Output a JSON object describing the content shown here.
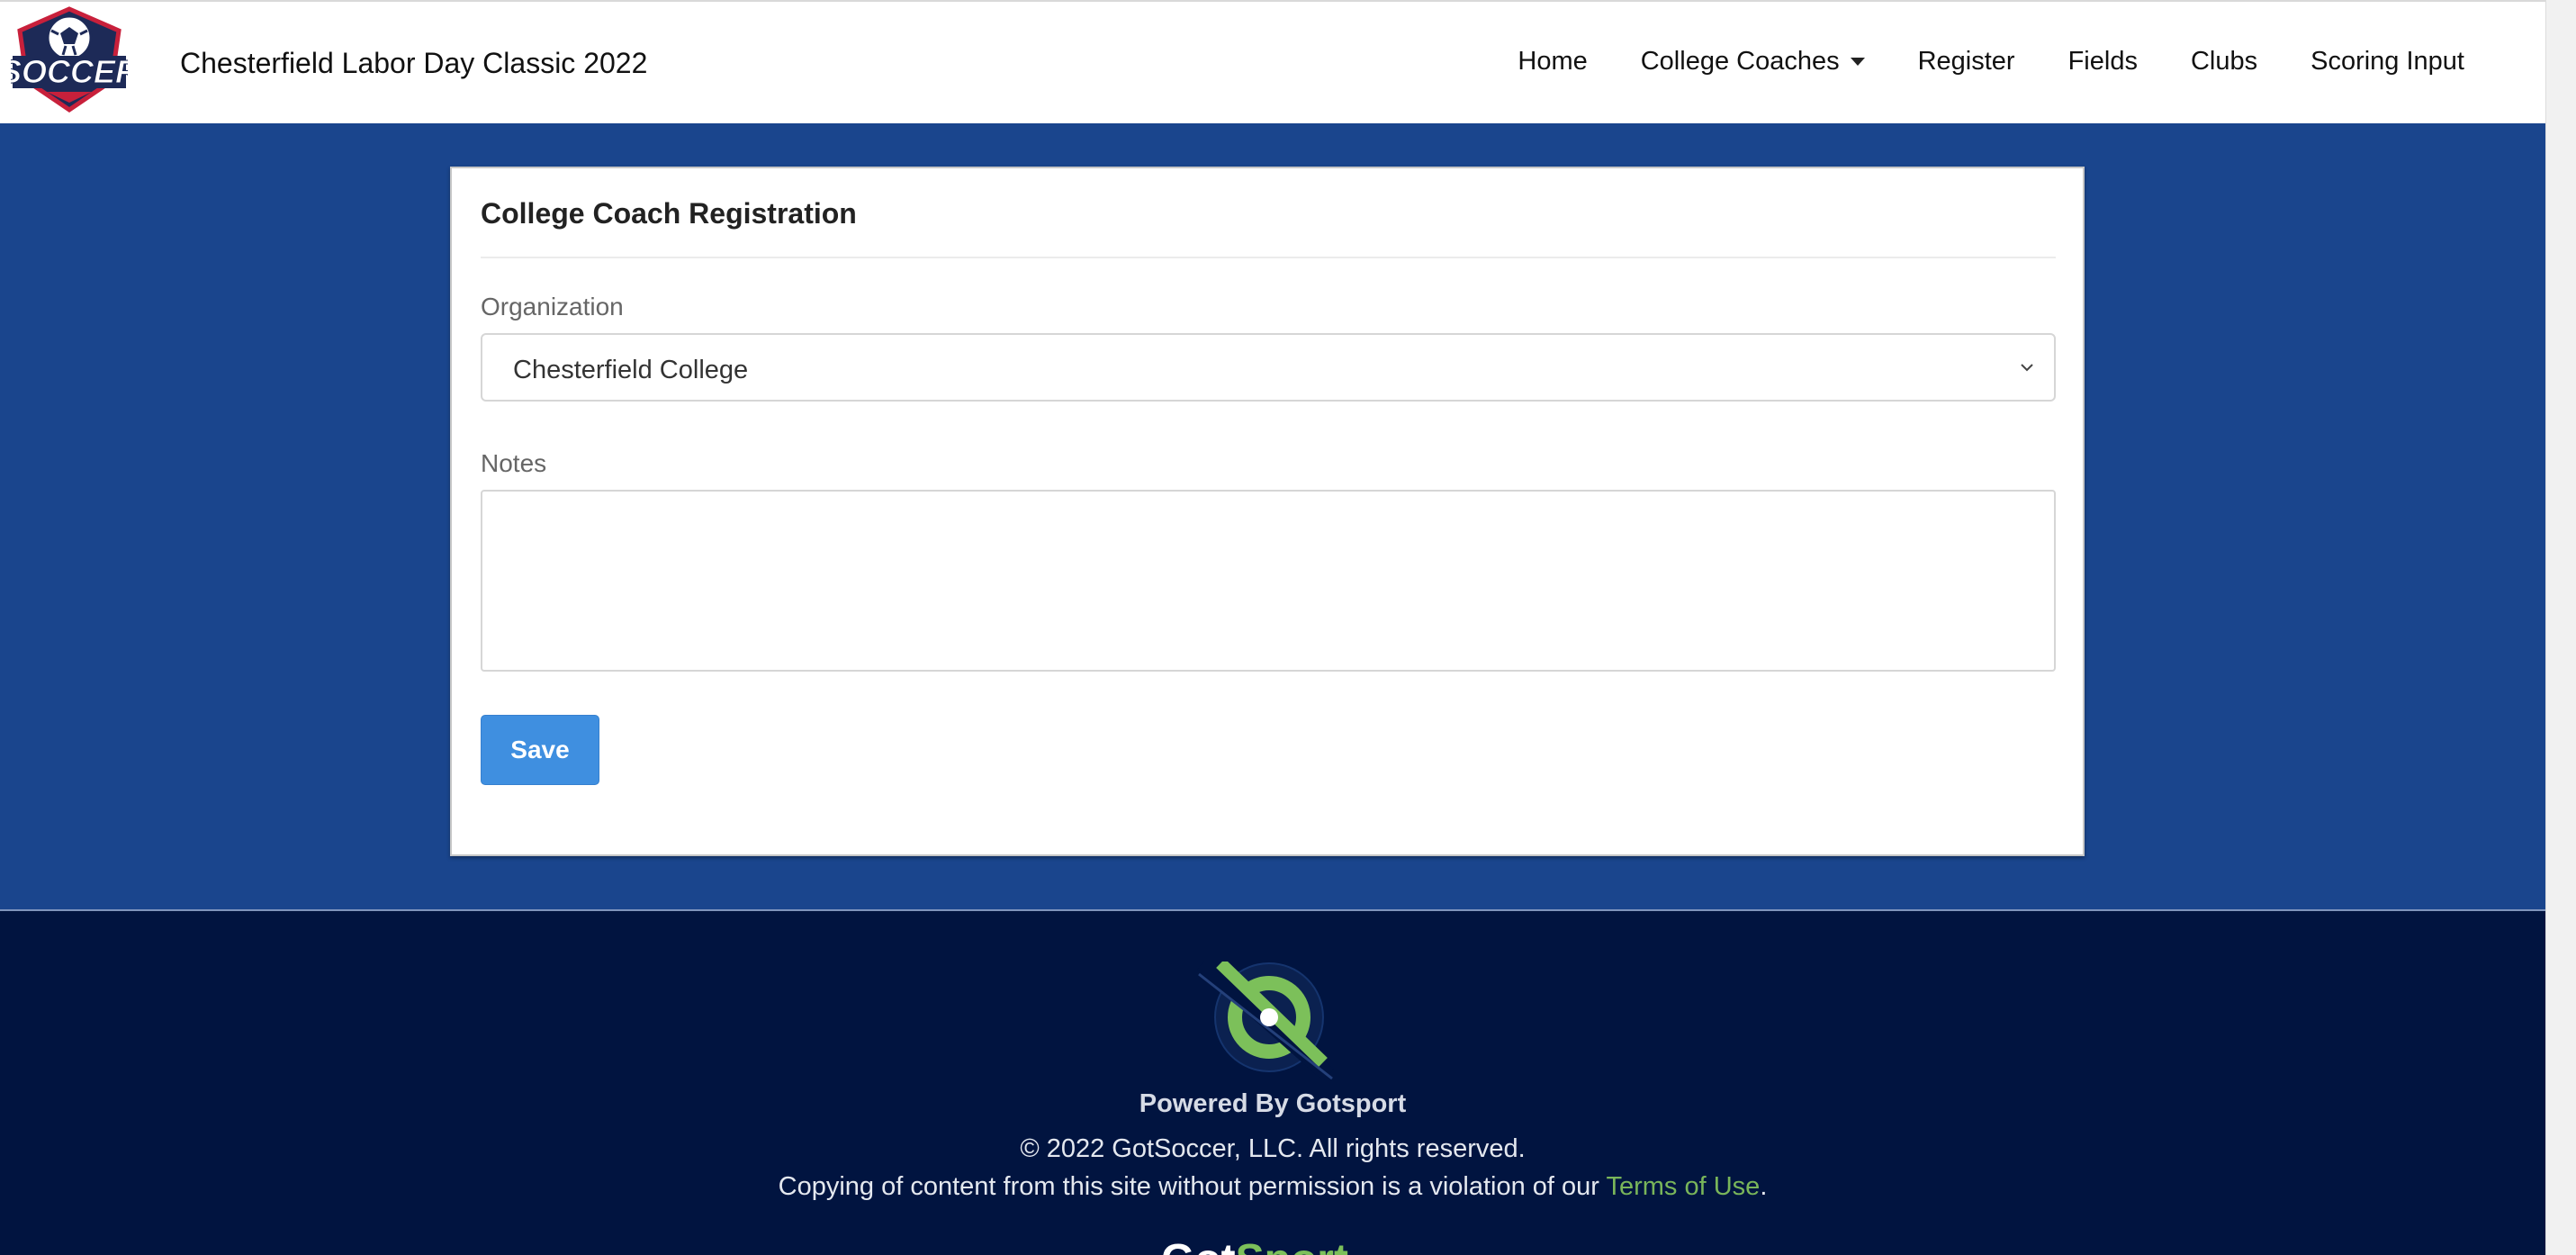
{
  "header": {
    "logo_text": "SOCCER",
    "site_title": "Chesterfield Labor Day Classic 2022",
    "nav": [
      {
        "label": "Home"
      },
      {
        "label": "College Coaches",
        "has_dropdown": true
      },
      {
        "label": "Register"
      },
      {
        "label": "Fields"
      },
      {
        "label": "Clubs"
      },
      {
        "label": "Scoring Input"
      }
    ]
  },
  "form": {
    "title": "College Coach Registration",
    "organization_label": "Organization",
    "organization_value": "Chesterfield College",
    "notes_label": "Notes",
    "notes_value": "",
    "save_label": "Save"
  },
  "footer": {
    "powered": "Powered By Gotsport",
    "copyright": "© 2022 GotSoccer, LLC. All rights reserved.",
    "copying_prefix": "Copying of content from this site without permission is a violation of our ",
    "terms_link": "Terms of Use",
    "copying_suffix": ".",
    "wordmark_got": "Got",
    "wordmark_sport": "Sport"
  },
  "colors": {
    "page_bg": "#1a458d",
    "footer_bg": "#011440",
    "primary_button": "#3f8fe0",
    "link_green": "#79b55a"
  }
}
